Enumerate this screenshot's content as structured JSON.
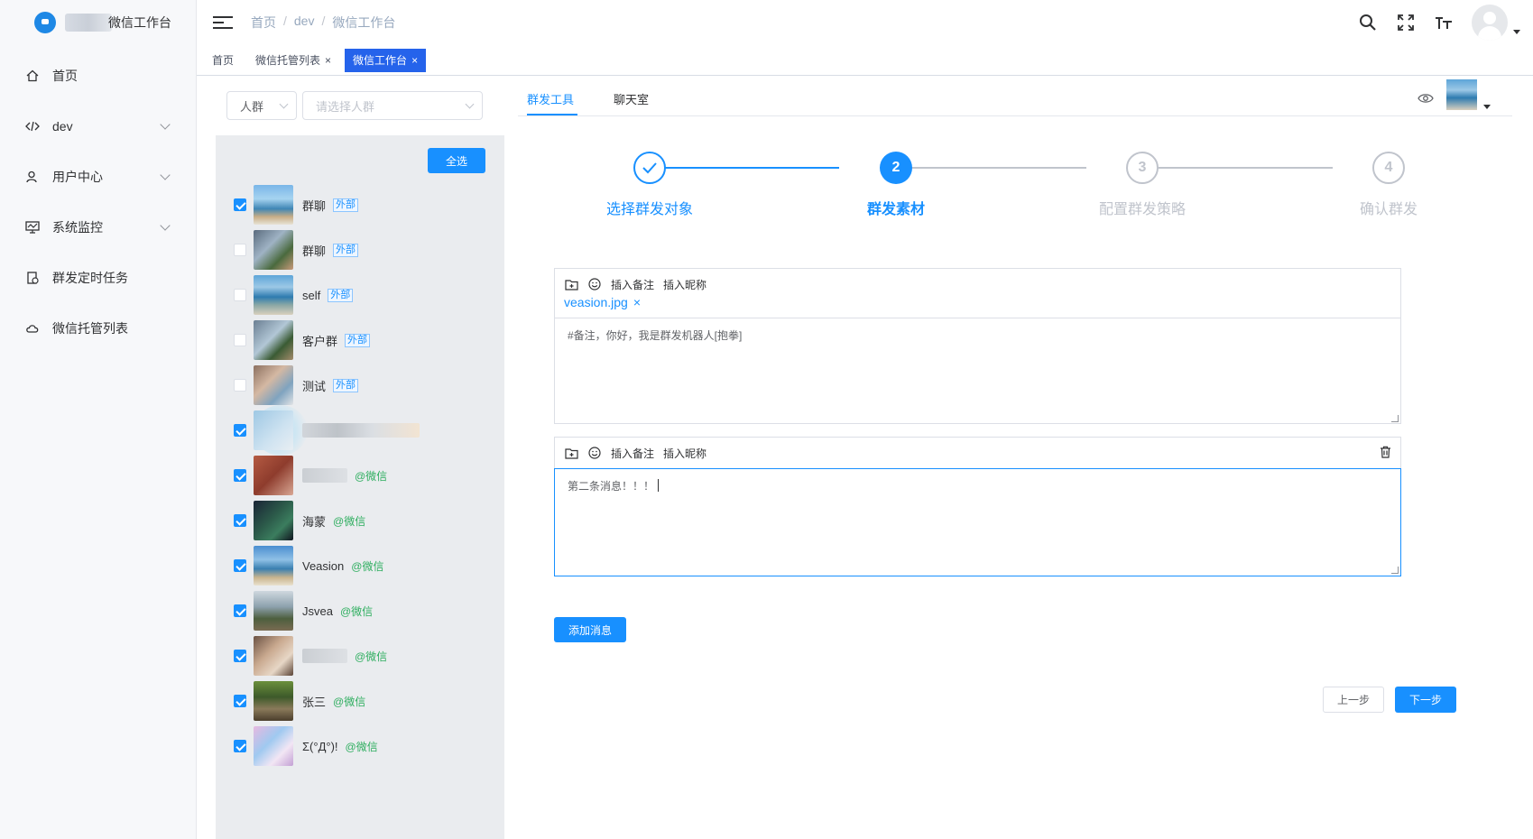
{
  "app": {
    "logo_title": "微信工作台"
  },
  "sidebar": {
    "items": [
      {
        "label": "首页",
        "icon": "home-icon"
      },
      {
        "label": "dev",
        "icon": "code-icon"
      },
      {
        "label": "用户中心",
        "icon": "user-icon"
      },
      {
        "label": "系统监控",
        "icon": "monitor-icon"
      },
      {
        "label": "群发定时任务",
        "icon": "task-icon"
      },
      {
        "label": "微信托管列表",
        "icon": "cloud-icon"
      }
    ]
  },
  "header": {
    "breadcrumb": [
      "首页",
      "dev",
      "微信工作台"
    ]
  },
  "tags": [
    {
      "label": "首页"
    },
    {
      "label": "微信托管列表"
    },
    {
      "label": "微信工作台"
    }
  ],
  "filter": {
    "type_value": "人群",
    "group_placeholder": "请选择人群",
    "select_all": "全选"
  },
  "contacts": [
    {
      "name": "群聊",
      "tag": "外部",
      "checked": true
    },
    {
      "name": "群聊",
      "tag": "外部",
      "checked": false
    },
    {
      "name": "self",
      "tag": "外部",
      "checked": false
    },
    {
      "name": "客户群",
      "tag": "外部",
      "checked": false
    },
    {
      "name": "测试",
      "tag": "外部",
      "checked": false
    },
    {
      "name": "",
      "tag": "",
      "checked": true
    },
    {
      "name": "",
      "tag": "@微信",
      "checked": true
    },
    {
      "name": "海蒙",
      "tag": "@微信",
      "checked": true
    },
    {
      "name": "Veasion",
      "tag": "@微信",
      "checked": true
    },
    {
      "name": "Jsvea",
      "tag": "@微信",
      "checked": true
    },
    {
      "name": "",
      "tag": "@微信",
      "checked": true
    },
    {
      "name": "张三",
      "tag": "@微信",
      "checked": true
    },
    {
      "name": "Σ(°Д°)!",
      "tag": "@微信",
      "checked": true
    }
  ],
  "main": {
    "subtabs": [
      "群发工具",
      "聊天室"
    ],
    "steps": [
      {
        "label": "选择群发对象",
        "num": "",
        "state": "done"
      },
      {
        "label": "群发素材",
        "num": "2",
        "state": "active"
      },
      {
        "label": "配置群发策略",
        "num": "3",
        "state": "wait"
      },
      {
        "label": "确认群发",
        "num": "4",
        "state": "wait"
      }
    ],
    "toolbar": {
      "insert_remark": "插入备注",
      "insert_nickname": "插入昵称"
    },
    "messages": [
      {
        "file": "veasion.jpg",
        "text": "#备注，你好，我是群发机器人[抱拳]"
      },
      {
        "file": "",
        "text": "第二条消息！！！"
      }
    ],
    "add_message": "添加消息",
    "prev": "上一步",
    "next": "下一步"
  },
  "colors": {
    "primary": "#1890ff",
    "wechat_green": "#2eae5f"
  }
}
